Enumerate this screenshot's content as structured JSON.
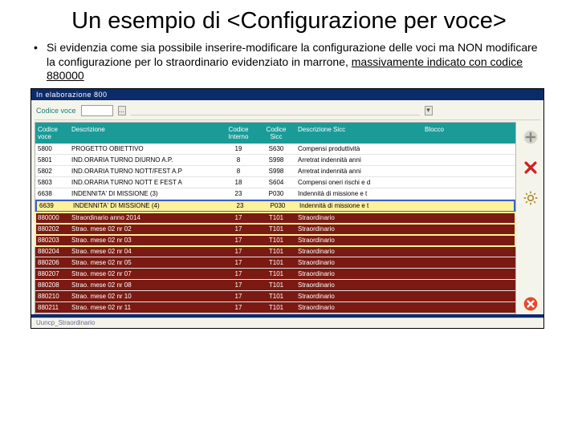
{
  "slide": {
    "title": "Un esempio di <Configurazione per voce>",
    "bullet_lead": "•",
    "bullet_text_a": "Si evidenzia come sia possibile inserire-modificare la configurazione delle voci ma NON modificare la configurazione per lo straordinario evidenziato in marrone, ",
    "bullet_text_u": "massivamente indicato con codice 880000"
  },
  "app": {
    "topbar": "In  elaborazione     800",
    "codice_label": "Codice voce",
    "dropdown_btn": "...",
    "footer": "Uuncp_Straordinario",
    "headers": {
      "code": "Codice voce",
      "desc": "Descrizione",
      "int": "Codice Interno",
      "sicc": "Codice Sicc",
      "dsic": "Descrizione Sicc",
      "blk": "Blocco"
    },
    "rows": [
      {
        "c": "5800",
        "d": "PROGETTO OBIETTIVO",
        "i": "19",
        "s": "S630",
        "ds": "Compensi produttività",
        "cls": ""
      },
      {
        "c": "5801",
        "d": "IND.ORARIA TURNO DIURNO A.P.",
        "i": "8",
        "s": "S998",
        "ds": "Arretrat indennità anni",
        "cls": ""
      },
      {
        "c": "5802",
        "d": "IND.ORARIA TURNO NOTT/FEST A.P",
        "i": "8",
        "s": "S998",
        "ds": "Arretrat indennità anni",
        "cls": ""
      },
      {
        "c": "5803",
        "d": "IND.ORARIA TURNO NOTT E FEST A",
        "i": "18",
        "s": "S604",
        "ds": "Compensi oneri rischi e d",
        "cls": ""
      },
      {
        "c": "6638",
        "d": "INDENNITA' DI MISSIONE (3)",
        "i": "23",
        "s": "P030",
        "ds": "Indennità di missione e t",
        "cls": ""
      },
      {
        "c": "6639",
        "d": "INDENNITA' DI MISSIONE (4)",
        "i": "23",
        "s": "P030",
        "ds": "Indennità di missione e t",
        "cls": "hl-yellow"
      },
      {
        "c": "880000",
        "d": "Straordinario anno 2014",
        "i": "17",
        "s": "T101",
        "ds": "Straordinario",
        "cls": "hl-maroon-y"
      },
      {
        "c": "880202",
        "d": "Strao. mese 02 nr 02",
        "i": "17",
        "s": "T101",
        "ds": "Straordinario",
        "cls": "hl-maroon-y"
      },
      {
        "c": "880203",
        "d": "Strao. mese 02 nr 03",
        "i": "17",
        "s": "T101",
        "ds": "Straordinario",
        "cls": "hl-maroon-y"
      },
      {
        "c": "880204",
        "d": "Strao. mese 02 nr 04",
        "i": "17",
        "s": "T101",
        "ds": "Straordinario",
        "cls": "hl-maroon"
      },
      {
        "c": "880206",
        "d": "Strao. mese 02 nr 05",
        "i": "17",
        "s": "T101",
        "ds": "Straordinario",
        "cls": "hl-maroon"
      },
      {
        "c": "880207",
        "d": "Strao. mese 02 nr 07",
        "i": "17",
        "s": "T101",
        "ds": "Straordinario",
        "cls": "hl-maroon"
      },
      {
        "c": "880208",
        "d": "Strao. mese 02 nr 08",
        "i": "17",
        "s": "T101",
        "ds": "Straordinario",
        "cls": "hl-maroon"
      },
      {
        "c": "880210",
        "d": "Strao. mese 02 nr 10",
        "i": "17",
        "s": "T101",
        "ds": "Straordinario",
        "cls": "hl-maroon"
      },
      {
        "c": "880211",
        "d": "Strao. mese 02 nr 11",
        "i": "17",
        "s": "T101",
        "ds": "Straordinario",
        "cls": "hl-maroon"
      }
    ]
  }
}
